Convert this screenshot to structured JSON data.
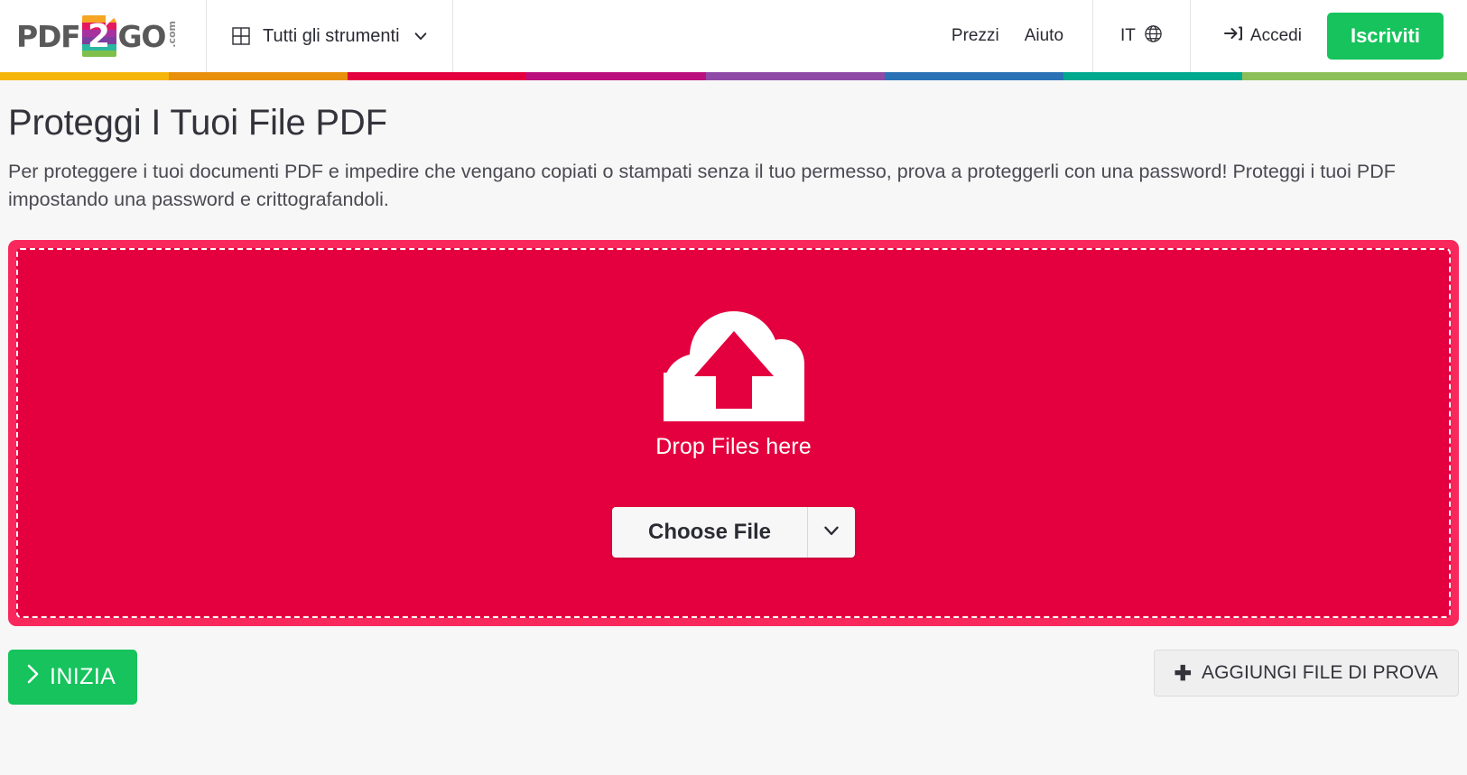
{
  "header": {
    "logo": {
      "part1": "PDF",
      "badge": "2",
      "part2": "GO",
      "suffix": ".com"
    },
    "tools_menu": {
      "label": "Tutti gli strumenti",
      "icon": "grid-icon",
      "chevron": "chevron-down-icon"
    },
    "nav_links": [
      {
        "label": "Prezzi"
      },
      {
        "label": "Aiuto"
      }
    ],
    "language": {
      "label": "IT",
      "icon": "globe-icon"
    },
    "login": {
      "label": "Accedi",
      "icon": "login-arrow-icon"
    },
    "signup": {
      "label": "Iscriviti",
      "color": "#16c35c"
    }
  },
  "stripe_bar": {
    "colors": [
      "#f5b50a",
      "#e8900b",
      "#e4003f",
      "#bc0f7e",
      "#8e4aa6",
      "#2a72b5",
      "#00a88e",
      "#8cbf58"
    ],
    "widths": [
      11.5,
      12.2,
      12.2,
      12.2,
      12.2,
      12.2,
      12.2,
      15.3
    ]
  },
  "main": {
    "title": "Proteggi I Tuoi File PDF",
    "description": "Per proteggere i tuoi documenti PDF e impedire che vengano copiati o stampati senza il tuo permesso, prova a proteggerli con una password! Proteggi i tuoi PDF impostando una password e crittografandoli."
  },
  "dropzone": {
    "icon": "cloud-upload-icon",
    "drop_text": "Drop Files here",
    "choose_file_label": "Choose File",
    "choose_file_chevron": "chevron-down-icon",
    "outer_color": "#f9285c",
    "inner_color": "#e4003f"
  },
  "actions": {
    "start": {
      "label": "INIZIA",
      "icon": "chevron-right-icon",
      "color": "#16c35c"
    },
    "sample": {
      "label": "AGGIUNGI FILE DI PROVA",
      "icon": "plus-icon"
    }
  }
}
